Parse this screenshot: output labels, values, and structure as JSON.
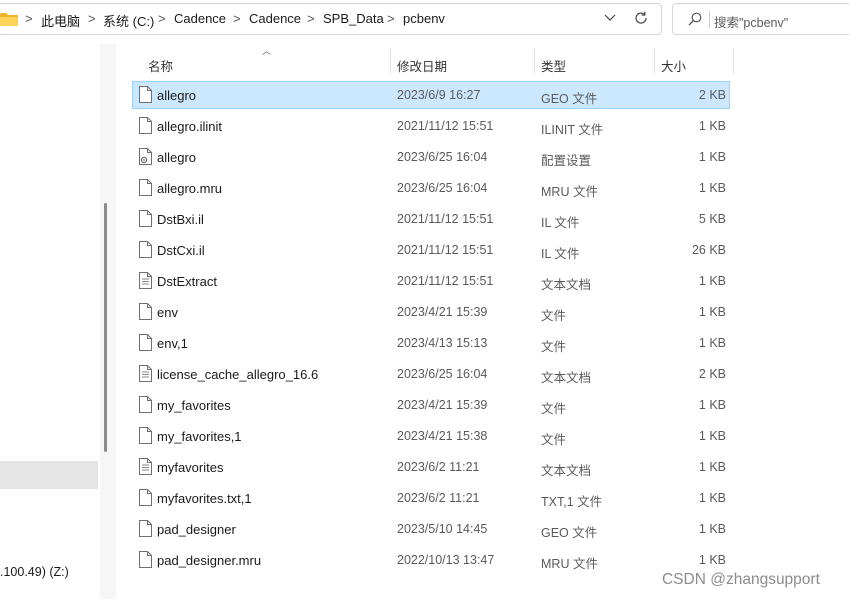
{
  "address_bar": {
    "breadcrumbs": [
      "此电脑",
      "系统 (C:)",
      "Cadence",
      "Cadence",
      "SPB_Data",
      "pcbenv"
    ],
    "separator": ">",
    "search_placeholder": "搜索\"pcbenv\""
  },
  "nav_pane": {
    "drive_label": ".100.49) (Z:)"
  },
  "columns": {
    "name": "名称",
    "modified": "修改日期",
    "type": "类型",
    "size": "大小"
  },
  "files": [
    {
      "name": "allegro",
      "modified": "2023/6/9 16:27",
      "type": "GEO 文件",
      "size": "2 KB",
      "icon": "file-icon",
      "selected": true
    },
    {
      "name": "allegro.ilinit",
      "modified": "2021/11/12 15:51",
      "type": "ILINIT 文件",
      "size": "1 KB",
      "icon": "file-icon"
    },
    {
      "name": "allegro",
      "modified": "2023/6/25 16:04",
      "type": "配置设置",
      "size": "1 KB",
      "icon": "settings-file-icon"
    },
    {
      "name": "allegro.mru",
      "modified": "2023/6/25 16:04",
      "type": "MRU 文件",
      "size": "1 KB",
      "icon": "file-icon"
    },
    {
      "name": "DstBxi.il",
      "modified": "2021/11/12 15:51",
      "type": "IL 文件",
      "size": "5 KB",
      "icon": "file-icon"
    },
    {
      "name": "DstCxi.il",
      "modified": "2021/11/12 15:51",
      "type": "IL 文件",
      "size": "26 KB",
      "icon": "file-icon"
    },
    {
      "name": "DstExtract",
      "modified": "2021/11/12 15:51",
      "type": "文本文档",
      "size": "1 KB",
      "icon": "text-file-icon"
    },
    {
      "name": "env",
      "modified": "2023/4/21 15:39",
      "type": "文件",
      "size": "1 KB",
      "icon": "file-icon"
    },
    {
      "name": "env,1",
      "modified": "2023/4/13 15:13",
      "type": "文件",
      "size": "1 KB",
      "icon": "file-icon"
    },
    {
      "name": "license_cache_allegro_16.6",
      "modified": "2023/6/25 16:04",
      "type": "文本文档",
      "size": "2 KB",
      "icon": "text-file-icon"
    },
    {
      "name": "my_favorites",
      "modified": "2023/4/21 15:39",
      "type": "文件",
      "size": "1 KB",
      "icon": "file-icon"
    },
    {
      "name": "my_favorites,1",
      "modified": "2023/4/21 15:38",
      "type": "文件",
      "size": "1 KB",
      "icon": "file-icon"
    },
    {
      "name": "myfavorites",
      "modified": "2023/6/2 11:21",
      "type": "文本文档",
      "size": "1 KB",
      "icon": "text-file-icon"
    },
    {
      "name": "myfavorites.txt,1",
      "modified": "2023/6/2 11:21",
      "type": "TXT,1 文件",
      "size": "1 KB",
      "icon": "file-icon"
    },
    {
      "name": "pad_designer",
      "modified": "2023/5/10 14:45",
      "type": "GEO 文件",
      "size": "1 KB",
      "icon": "file-icon"
    },
    {
      "name": "pad_designer.mru",
      "modified": "2022/10/13 13:47",
      "type": "MRU 文件",
      "size": "1 KB",
      "icon": "file-icon"
    }
  ],
  "watermark": "CSDN @zhangsupport",
  "colors": {
    "selected_row": "#cce8ff",
    "selected_border": "#99d1ff",
    "folder": "#f4c430"
  }
}
